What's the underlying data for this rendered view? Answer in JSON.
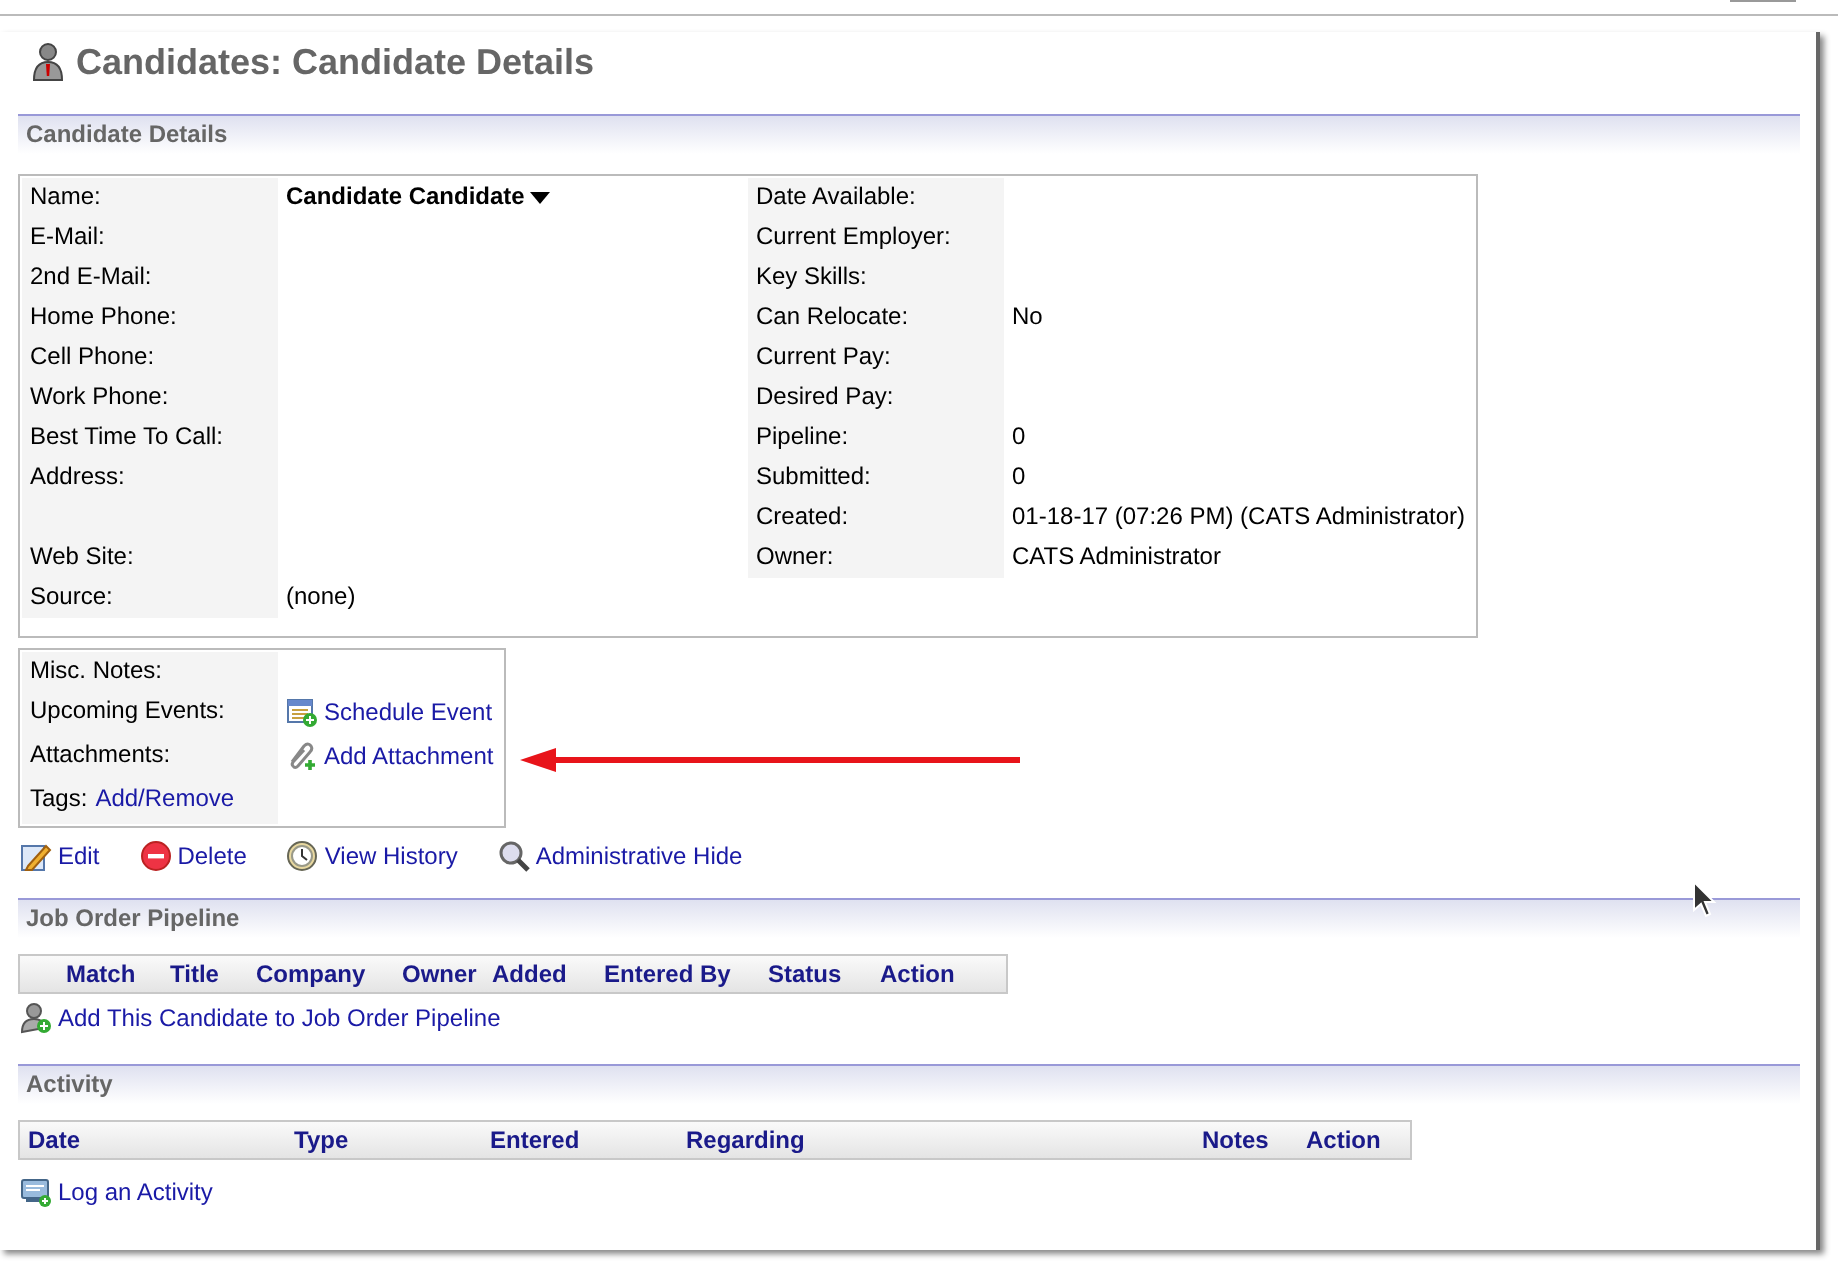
{
  "page_title": "Candidates: Candidate Details",
  "details": {
    "header": "Candidate Details",
    "left_fields": [
      {
        "label": "Name:",
        "value": "Candidate Candidate",
        "kind": "name"
      },
      {
        "label": "E-Mail:",
        "kind": "text"
      },
      {
        "label": "2nd E-Mail:",
        "kind": "text"
      },
      {
        "label": "Home Phone:",
        "kind": "text"
      },
      {
        "label": "Cell Phone:",
        "kind": "text"
      },
      {
        "label": "Work Phone:",
        "kind": "text"
      },
      {
        "label": "Best Time To Call:",
        "kind": "text"
      },
      {
        "label": "Address:",
        "kind": "multiline"
      },
      {
        "label": "Web Site:",
        "kind": "text"
      },
      {
        "label": "Source:",
        "value": "(none)",
        "kind": "text"
      }
    ],
    "right_fields": [
      {
        "label": "Date Available:"
      },
      {
        "label": "Current Employer:"
      },
      {
        "label": "Key Skills:"
      },
      {
        "label": "Can Relocate:",
        "value": "No"
      },
      {
        "label": "Current Pay:"
      },
      {
        "label": "Desired Pay:"
      },
      {
        "label": "Pipeline:",
        "value": "0"
      },
      {
        "label": "Submitted:",
        "value": "0"
      },
      {
        "label": "Created:",
        "value": "01-18-17 (07:26 PM) (CATS Administrator)"
      },
      {
        "label": "Owner:",
        "value": "CATS Administrator"
      }
    ],
    "misc": [
      {
        "label": "Misc. Notes:",
        "kind": "empty"
      },
      {
        "label": "Upcoming Events:",
        "kind": "link",
        "link": "Schedule Event"
      },
      {
        "label": "Attachments:",
        "kind": "link",
        "link": "Add Attachment"
      },
      {
        "label": "Tags:",
        "kind": "inline",
        "link": "Add/Remove"
      }
    ],
    "actions": [
      "Edit",
      "Delete",
      "View History",
      "Administrative Hide"
    ]
  },
  "pipeline": {
    "header": "Job Order Pipeline",
    "columns": [
      "Match",
      "Title",
      "Company",
      "Owner",
      "Added",
      "Entered By",
      "Status",
      "Action"
    ],
    "add_link": "Add This Candidate to Job Order Pipeline"
  },
  "activity": {
    "header": "Activity",
    "columns": [
      "Date",
      "Type",
      "Entered",
      "Regarding",
      "Notes",
      "Action"
    ],
    "add_link": "Log an Activity"
  }
}
